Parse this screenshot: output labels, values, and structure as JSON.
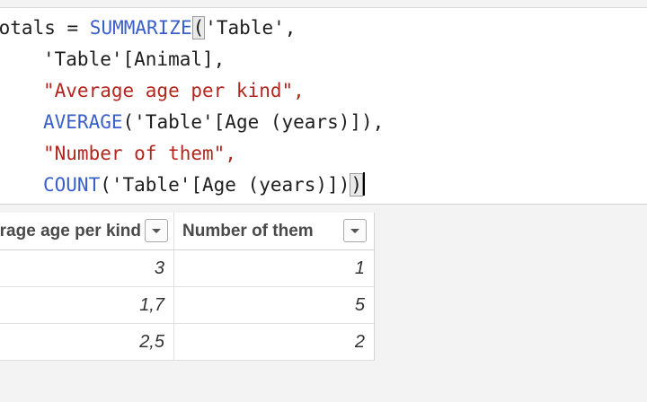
{
  "formula": {
    "lines": [
      {
        "measure": "Totals = ",
        "fn": "SUMMARIZE",
        "open_paren": "(",
        "args": "'Table',"
      },
      {
        "text": "'Table'[Animal],"
      },
      {
        "text": "\"Average age per kind\","
      },
      {
        "fn": "AVERAGE",
        "args": "('Table'[Age (years)]),"
      },
      {
        "text": "\"Number of them\","
      },
      {
        "fn": "COUNT",
        "args": "('Table'[Age (years)])",
        "close_paren": ")"
      }
    ]
  },
  "table": {
    "columns": [
      {
        "label": "Average age per kind"
      },
      {
        "label": "Number of them"
      }
    ],
    "rows": [
      {
        "avg": "3",
        "count": "1"
      },
      {
        "avg": "1,7",
        "count": "5"
      },
      {
        "avg": "2,5",
        "count": "2"
      }
    ]
  },
  "colors": {
    "function": "#3a5fc9",
    "string": "#b3261e"
  }
}
